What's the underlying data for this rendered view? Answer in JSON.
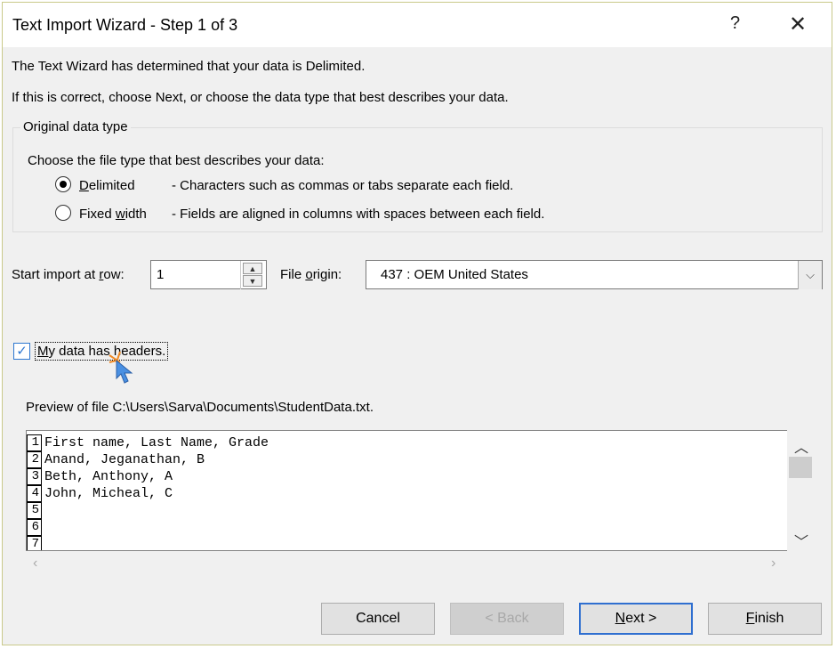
{
  "window": {
    "title": "Text Import Wizard - Step 1 of 3",
    "help": "?",
    "close": "✕"
  },
  "intro": {
    "line1": "The Text Wizard has determined that your data is Delimited.",
    "line2": "If this is correct, choose Next, or choose the data type that best describes your data."
  },
  "original_type": {
    "legend": "Original data type",
    "prompt": "Choose the file type that best describes your data:",
    "options": [
      {
        "label_u": "D",
        "label_rest": "elimited",
        "desc": "- Characters such as commas or tabs separate each field.",
        "selected": true
      },
      {
        "label_pre": "Fixed ",
        "label_u": "w",
        "label_rest": "idth",
        "desc": "- Fields are aligned in columns with spaces between each field.",
        "selected": false
      }
    ]
  },
  "start_row": {
    "label_pre": "Start import at ",
    "label_u": "r",
    "label_rest": "ow:",
    "value": "1"
  },
  "file_origin": {
    "label_pre": "File ",
    "label_u": "o",
    "label_rest": "rigin:",
    "value": "437 : OEM United States"
  },
  "headers_checkbox": {
    "label_u": "M",
    "label_rest": "y data has headers.",
    "checked": true
  },
  "preview": {
    "label": "Preview of file C:\\Users\\Sarva\\Documents\\StudentData.txt.",
    "line_numbers": [
      "1",
      "2",
      "3",
      "4",
      "5",
      "6",
      "7"
    ],
    "rows": [
      "First name, Last Name, Grade",
      "Anand, Jeganathan, B",
      "Beth, Anthony, A",
      "John, Micheal, C",
      "",
      "",
      ""
    ]
  },
  "buttons": {
    "cancel": "Cancel",
    "back": "< Back",
    "next_u": "N",
    "next_rest": "ext >",
    "finish_u": "F",
    "finish_rest": "inish"
  },
  "colors": {
    "accent": "#2e77d0",
    "cursor": "#4a90e2",
    "click_marker": "#f08a24"
  }
}
